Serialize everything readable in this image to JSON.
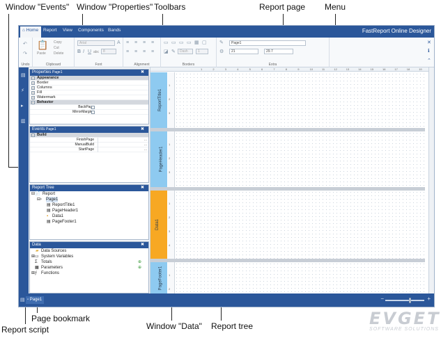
{
  "annotations": {
    "window_events": "Window \"Events\"",
    "window_properties": "Window \"Properties\"",
    "toolbars": "Toolbars",
    "report_page": "Report page",
    "menu": "Menu",
    "report_script": "Report script",
    "page_bookmark": "Page bookmark",
    "window_data": "Window \"Data\"",
    "report_tree": "Report tree"
  },
  "menu": {
    "tabs": [
      "Home",
      "Report",
      "View",
      "Components",
      "Bands"
    ],
    "brand": "FastReport Online Designer"
  },
  "ribbon": {
    "undo_label": "Undo",
    "clipboard": {
      "label": "Clipboard",
      "paste": "Paste",
      "copy": "Copy",
      "cut": "Cut",
      "delete": "Delete"
    },
    "font": {
      "label": "Font",
      "name": "Arial",
      "size": "8",
      "abc": "abc"
    },
    "alignment_label": "Alignment",
    "borders": {
      "label": "Borders",
      "dash_style": "Dash",
      "width": "1"
    },
    "extra": {
      "label": "Extra",
      "page_name": "Page1",
      "width": "21",
      "height": "29.7"
    }
  },
  "properties": {
    "title": "Properties",
    "object": "Page1",
    "categories": [
      "Appearance",
      "Border",
      "Columns",
      "Fill",
      "Watermark",
      "Behavior"
    ],
    "behavior_rows": [
      "BackPage",
      "MirrorMargins"
    ]
  },
  "events": {
    "title": "Events",
    "object": "Page1",
    "category": "Build",
    "rows": [
      "FinishPage",
      "ManualBuild",
      "StartPage"
    ],
    "ellipsis": "..."
  },
  "report_tree": {
    "title": "Report Tree",
    "root": "Report",
    "page": "Page1",
    "children": [
      "ReportTitle1",
      "PageHeader1",
      "Data1",
      "PageFooter1"
    ]
  },
  "data_window": {
    "title": "Data",
    "items": [
      "Data Sources",
      "System Variables",
      "Totals",
      "Parameters",
      "Functions"
    ]
  },
  "bands": [
    "ReportTitle1",
    "PageHeader1",
    "Data1",
    "PageFooter1"
  ],
  "ruler_ticks": [
    "1",
    "2",
    "3",
    "4",
    "5",
    "6",
    "7",
    "8",
    "9",
    "10",
    "11",
    "12",
    "13",
    "14",
    "15",
    "16",
    "17",
    "18",
    "19"
  ],
  "page_tab": "Page1",
  "watermark": {
    "line1": "EVGET",
    "line2": "SOFTWARE SOLUTIONS"
  },
  "colors": {
    "accent": "#2b579a",
    "band_blue": "#8ecaf0",
    "band_orange": "#f7a823"
  }
}
